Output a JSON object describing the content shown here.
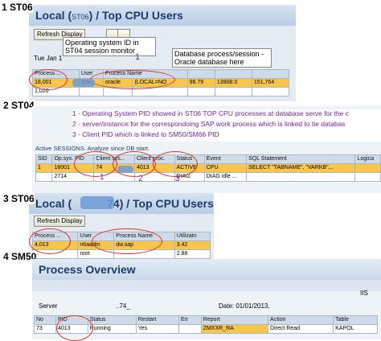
{
  "st06_top": {
    "section_label": "1 ST06",
    "title_left": "Local (",
    "title_mid": "ST06",
    "title_right": ") / Top CPU Users",
    "refresh_button": "Refresh Display",
    "date_text": "Tue Jan 1",
    "marker": "1",
    "annot_os_pid": "Operating system ID in ST04 session monitor",
    "annot_db_process": "Database process/session - Oracle database here",
    "columns": [
      "Process ...",
      "User",
      "Process Name",
      "",
      ""
    ],
    "rows": [
      [
        "18,001",
        "oran",
        "oracle",
        "(LOCAL=NO",
        "98.79",
        "13908:3",
        "151,764"
      ],
      [
        "1,020",
        "",
        "",
        "",
        "",
        "",
        ""
      ]
    ]
  },
  "st04": {
    "section_label": "2 ST04",
    "annot_lines": [
      "1 - Operating System PID showed in ST06 TOP CPU processes at database serve for the c",
      "2 - server/instance for the correspondoing SAP work process which is linked to tie databas",
      "3 - Client PID which is linked to SM50/SM66 PID"
    ],
    "active_sessions_text": "Active SESSIONS. Analyze since DB start.",
    "columns": [
      "SID",
      "Op.sys. PID",
      "Client sys...",
      "Client proc.",
      "Status",
      "Event",
      "SQL Statement",
      "Logica"
    ],
    "rows": [
      [
        "1",
        "18001",
        "74",
        "4013",
        "ACTIVE",
        "CPU",
        "SELECT \"TABNAME\", \"VARKB\"...",
        ""
      ],
      [
        "",
        "2714",
        "",
        "",
        "DIAG",
        "DIAG idle ...",
        "",
        ""
      ]
    ],
    "markers": [
      "1",
      "2",
      "3"
    ]
  },
  "st06_mid": {
    "section_label": "3 ST06",
    "title_left": "Local (",
    "title_right": "74) / Top CPU Users",
    "refresh_button": "Refresh Display",
    "columns": [
      "Process ...",
      "User",
      "Process Name",
      "Utilizatn"
    ],
    "rows": [
      [
        "4,013",
        "n6aadm",
        "dw.sap",
        "3.42"
      ],
      [
        "...",
        "root",
        "",
        "2.88"
      ]
    ]
  },
  "sm50": {
    "section_label": "4 SM50",
    "title": "Process Overview",
    "server_label": "Server",
    "server_value": "..74_",
    "date_text": "Date: 01/01/2013,",
    "columns": [
      "No",
      "PID",
      "Status",
      "Restart",
      "Err",
      "Report",
      "Action",
      "Table"
    ],
    "row": [
      "73",
      "4013",
      "Running",
      "Yes",
      "",
      "ZMXXR_RA",
      "Direct Read",
      "KAPOL"
    ],
    "right_tag": "IIS"
  },
  "colors": {
    "highlight": "#f8c64b",
    "annotation": "#7a1fa2",
    "ellipse": "#e0342a",
    "title": "#1d3b6b"
  }
}
